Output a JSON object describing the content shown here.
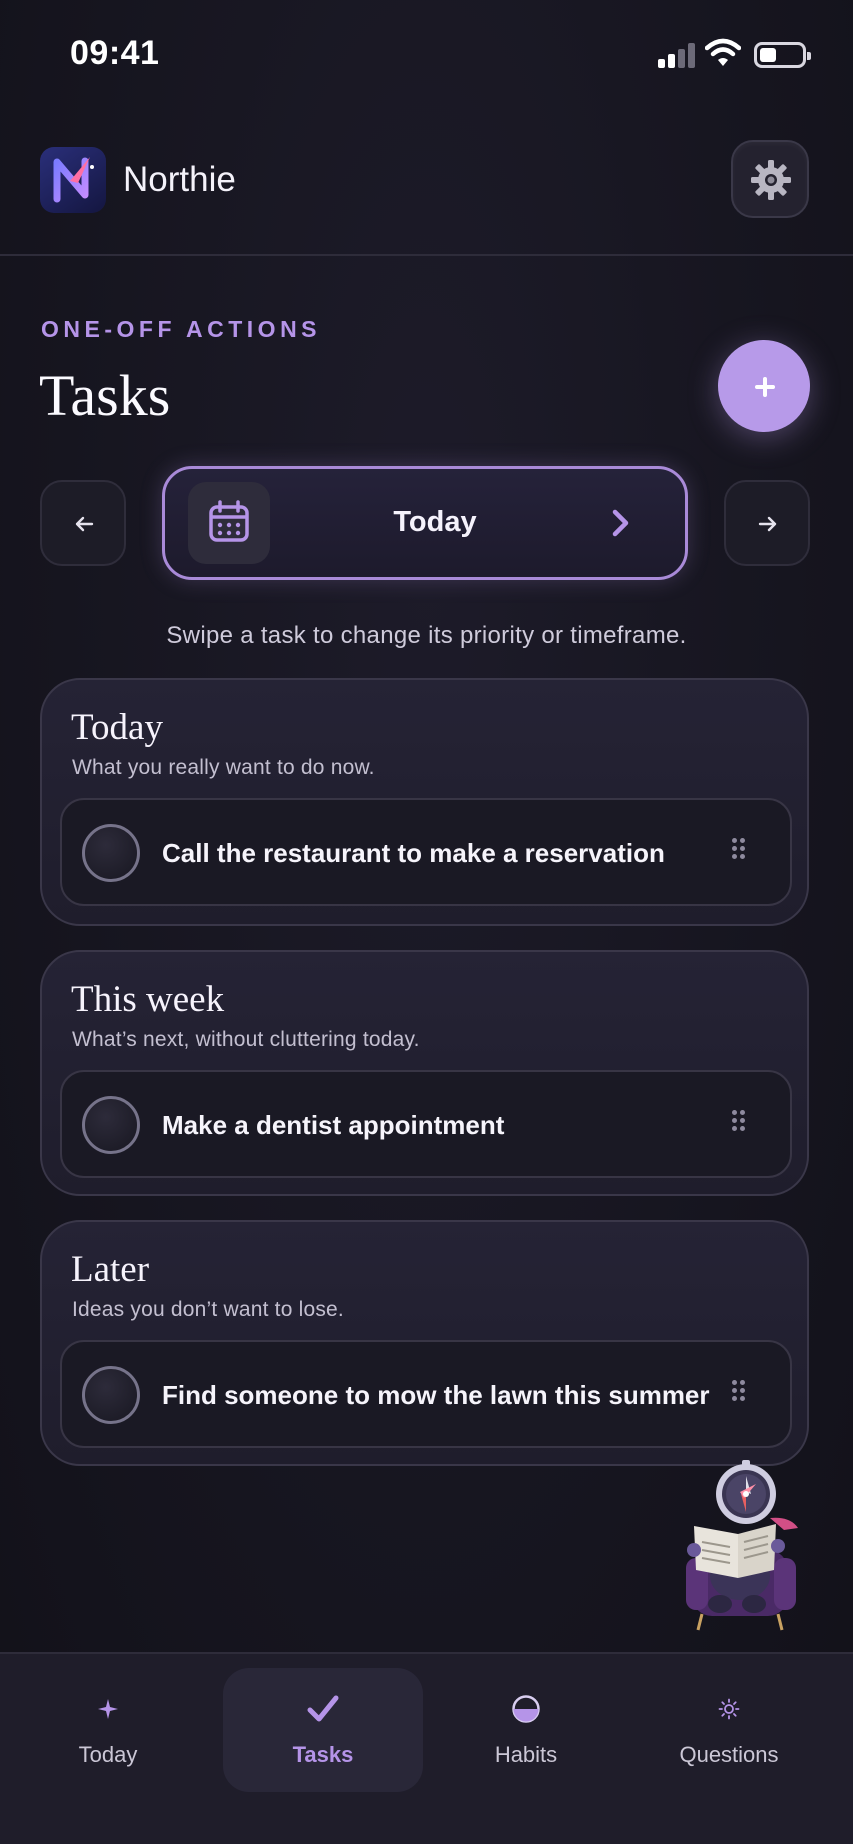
{
  "status_bar": {
    "time": "09:41"
  },
  "header": {
    "app_name": "Northie"
  },
  "section": {
    "eyebrow": "ONE-OFF ACTIONS",
    "title": "Tasks"
  },
  "date_nav": {
    "label": "Today"
  },
  "hint": "Swipe a task to change its priority or timeframe.",
  "groups": [
    {
      "title": "Today",
      "subtitle": "What you really want to do now.",
      "tasks": [
        {
          "label": "Call the restaurant to make a reservation",
          "done": false
        }
      ]
    },
    {
      "title": "This week",
      "subtitle": "What’s next, without cluttering today.",
      "tasks": [
        {
          "label": "Make a dentist appointment",
          "done": false
        }
      ]
    },
    {
      "title": "Later",
      "subtitle": "Ideas you don’t want to lose.",
      "tasks": [
        {
          "label": "Find someone to mow the lawn this summer",
          "done": false
        }
      ]
    }
  ],
  "tab_bar": {
    "active": "Tasks",
    "tabs": [
      {
        "label": "Today",
        "icon": "sparkle-icon"
      },
      {
        "label": "Tasks",
        "icon": "checkmark-icon"
      },
      {
        "label": "Habits",
        "icon": "half-circle-icon"
      },
      {
        "label": "Questions",
        "icon": "sun-icon"
      }
    ]
  },
  "colors": {
    "accent": "#b594e8",
    "background": "#16151f",
    "card": "#252335"
  }
}
